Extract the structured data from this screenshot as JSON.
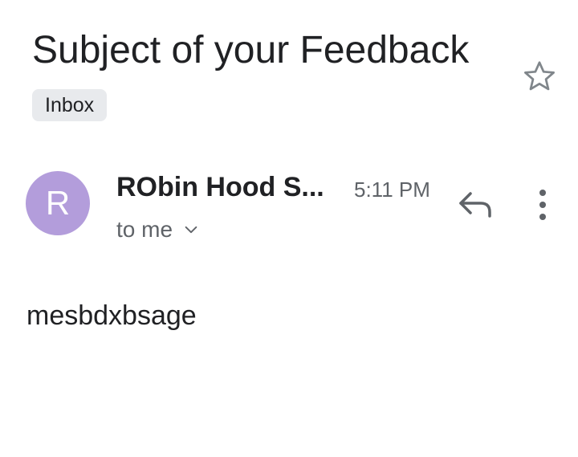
{
  "message": {
    "subject": "Subject of your Feedback",
    "label": "Inbox",
    "sender": {
      "initial": "R",
      "name": "RObin Hood S...",
      "avatar_color": "#b39ddb"
    },
    "time": "5:11 PM",
    "recipients": "to me",
    "body": "mesbdxbsage"
  },
  "icons": {
    "star": "star-outline-icon",
    "reply": "reply-icon",
    "more": "more-vert-icon",
    "recipients_toggle": "chevron-down-icon"
  },
  "colors": {
    "text_primary": "#202124",
    "text_secondary": "#5f6368",
    "chip_background": "#e8eaed"
  }
}
